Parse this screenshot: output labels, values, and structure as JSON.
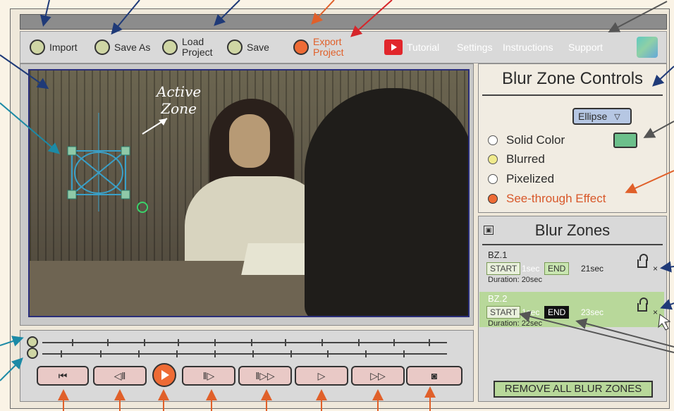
{
  "toolbar": {
    "import_label": "Import",
    "save_as_label": "Save As",
    "load_project_line1": "Load",
    "load_project_line2": "Project",
    "save_label": "Save",
    "export_line1": "Export",
    "export_line2": "Project",
    "tutorial_label": "Tutorial",
    "settings_label": "Settings",
    "instructions_label": "Instructions",
    "support_label": "Support"
  },
  "video": {
    "active_zone_line1": "Active",
    "active_zone_line2": "Zone"
  },
  "controls": {
    "title": "Blur Zone Controls",
    "shape_selected": "Ellipse",
    "options": [
      "Solid Color",
      "Blurred",
      "Pixelized",
      "See-through Effect"
    ],
    "selected_option": "See-through Effect"
  },
  "zones": {
    "title": "Blur Zones",
    "items": [
      {
        "name": "BZ.1",
        "start_label": "START",
        "start_value": "1sec",
        "end_label": "END",
        "end_value": "21sec",
        "duration": "Duration: 20sec",
        "remove": "×"
      },
      {
        "name": "BZ.2",
        "start_label": "START",
        "start_value": "1sec",
        "end_label": "END",
        "end_value": "23sec",
        "duration": "Duration: 22sec",
        "remove": "×"
      }
    ],
    "remove_all_label": "REMOVE ALL BLUR ZONES"
  },
  "colors": {
    "accent_orange": "#ee6b35",
    "zone_green": "#b8d89a",
    "swatch_green": "#6cc08b",
    "youtube_red": "#e1262b"
  },
  "icons": [
    "play-icon",
    "skip-start-icon",
    "step-back-icon",
    "step-forward-icon",
    "fast-forward-frame-icon",
    "next-icon",
    "fast-forward-icon",
    "snapshot-icon",
    "lock-icon",
    "youtube-icon",
    "app-logo-icon"
  ]
}
